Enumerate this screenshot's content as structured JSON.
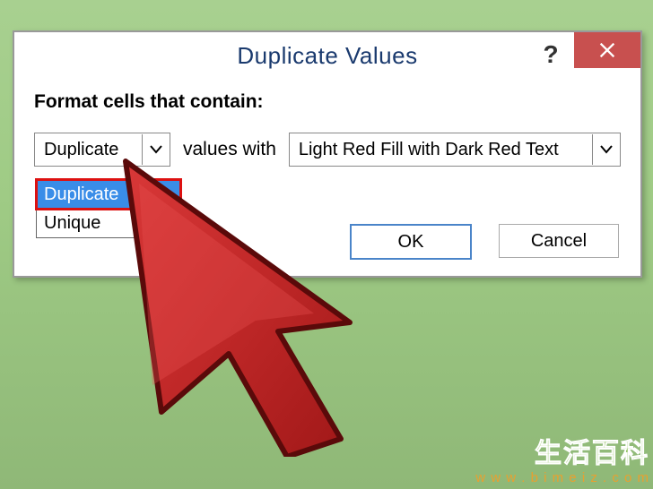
{
  "dialog": {
    "title": "Duplicate Values",
    "instruction": "Format cells that contain:",
    "type_combo": {
      "value": "Duplicate"
    },
    "middle_text": "values with",
    "format_combo": {
      "value": "Light Red Fill with Dark Red Text"
    },
    "dropdown_options": {
      "opt0": "Duplicate",
      "opt1": "Unique"
    },
    "buttons": {
      "ok": "OK",
      "cancel": "Cancel"
    }
  },
  "watermark": {
    "cn": "生活百科",
    "url": "w w w . b i m e i z . c o m"
  }
}
